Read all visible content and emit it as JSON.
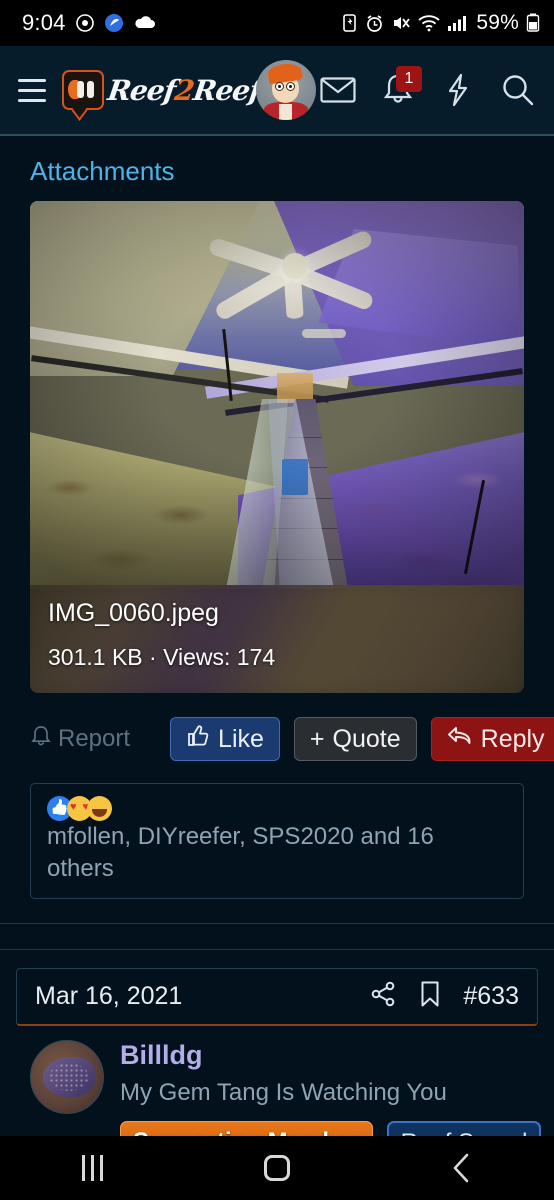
{
  "statusbar": {
    "time": "9:04",
    "battery_percent": "59%",
    "icons": [
      "target-icon",
      "app-icon",
      "cloud-icon",
      "battery-saver-icon",
      "alarm-icon",
      "mute-icon",
      "wifi-icon",
      "signal-icon",
      "battery-icon"
    ]
  },
  "header": {
    "menu_icon": "hamburger-menu-icon",
    "logo_text_1": "Reef",
    "logo_text_2": "2",
    "logo_text_3": "Reef",
    "avatar": "user-avatar",
    "mail_icon": "envelope-icon",
    "alerts_icon": "bell-icon",
    "alerts_count": "1",
    "bolt_icon": "lightning-bolt-icon",
    "search_icon": "search-icon"
  },
  "attachments": {
    "title": "Attachments",
    "file": {
      "name": "IMG_0060.jpeg",
      "meta": "301.1 KB · Views: 174",
      "size": "301.1 KB",
      "views_label": "Views:",
      "views": "174"
    }
  },
  "actions": {
    "report": "Report",
    "like": "Like",
    "quote": "+ Quote",
    "quote_plus": "+",
    "quote_label": "Quote",
    "reply": "Reply"
  },
  "reactions": {
    "emoji": [
      "thumbs-up",
      "heart-eyes",
      "laughing"
    ],
    "names": "mfollen, DIYreefer, SPS2020 and 16 others"
  },
  "next_post": {
    "date": "Mar 16, 2021",
    "share_icon": "share-icon",
    "bookmark_icon": "bookmark-icon",
    "post_number": "#633",
    "username": "Billldg",
    "user_tagline": "My Gem Tang Is Watching You",
    "badges": [
      {
        "label": "Supporting Member",
        "color": "#d9600f"
      },
      {
        "label": "Reef Squad",
        "color": "#3b74c4"
      }
    ]
  },
  "navbar": {
    "recents": "recents-icon",
    "home": "home-icon",
    "back": "back-icon"
  },
  "colors": {
    "page_bg": "#03111d",
    "header_bg": "#071c2b",
    "accent_blue": "#4fb3e8",
    "like_blue": "#1b3a70",
    "reply_red": "#8e1414",
    "badge_red": "#9c1414",
    "orange": "#d9600f",
    "username_purple": "#b3aee8"
  }
}
